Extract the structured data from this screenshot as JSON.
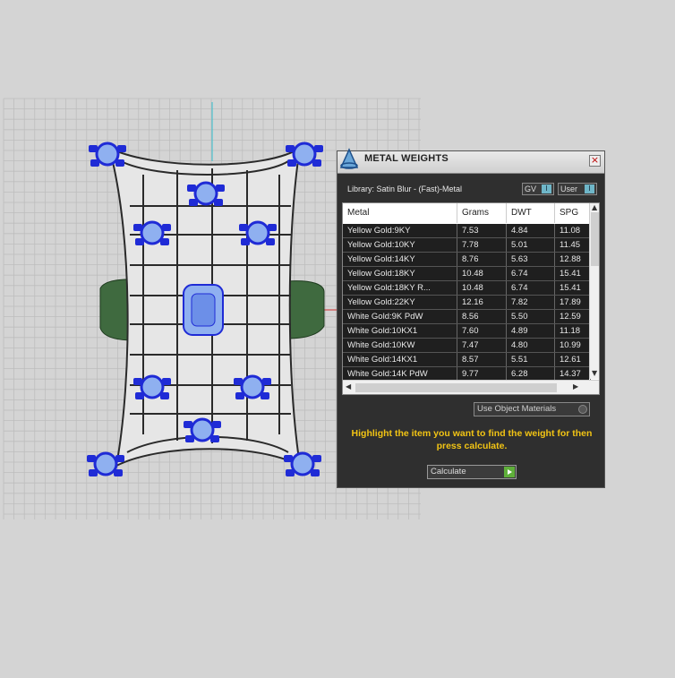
{
  "window": {
    "title": "METAL WEIGHTS",
    "library_label": "Library: Satin Blur - (Fast)-Metal",
    "close_glyph": "×"
  },
  "toggles": {
    "gv": {
      "label": "GV",
      "knob": "I"
    },
    "user": {
      "label": "User",
      "knob": "I"
    }
  },
  "table": {
    "columns": [
      "Metal",
      "Grams",
      "DWT",
      "SPG"
    ],
    "rows": [
      [
        "Yellow Gold:9KY",
        "7.53",
        "4.84",
        "11.08"
      ],
      [
        "Yellow Gold:10KY",
        "7.78",
        "5.01",
        "11.45"
      ],
      [
        "Yellow Gold:14KY",
        "8.76",
        "5.63",
        "12.88"
      ],
      [
        "Yellow Gold:18KY",
        "10.48",
        "6.74",
        "15.41"
      ],
      [
        "Yellow Gold:18KY R...",
        "10.48",
        "6.74",
        "15.41"
      ],
      [
        "Yellow Gold:22KY",
        "12.16",
        "7.82",
        "17.89"
      ],
      [
        "White Gold:9K PdW",
        "8.56",
        "5.50",
        "12.59"
      ],
      [
        "White Gold:10KX1",
        "7.60",
        "4.89",
        "11.18"
      ],
      [
        "White Gold:10KW",
        "7.47",
        "4.80",
        "10.99"
      ],
      [
        "White Gold:14KX1",
        "8.57",
        "5.51",
        "12.61"
      ],
      [
        "White Gold:14K PdW",
        "9.77",
        "6.28",
        "14.37"
      ]
    ]
  },
  "use_object_materials": {
    "label": "Use Object Materials"
  },
  "instruction": "Highlight the item you want to find the weight for then press calculate.",
  "calculate_button": {
    "label": "Calculate"
  },
  "colors": {
    "panel_bg": "#2f2f2f",
    "instruction": "#f2c414",
    "ring_metal": "#d9d9d9",
    "gem_blue": "#1f2bd6",
    "band_green": "#3f6a3f",
    "grid": "#bdbdbd"
  },
  "icons": [
    "close-icon",
    "app-logo-icon",
    "scroll-up-icon",
    "scroll-down-icon",
    "scroll-left-icon",
    "scroll-right-icon",
    "play-icon"
  ]
}
